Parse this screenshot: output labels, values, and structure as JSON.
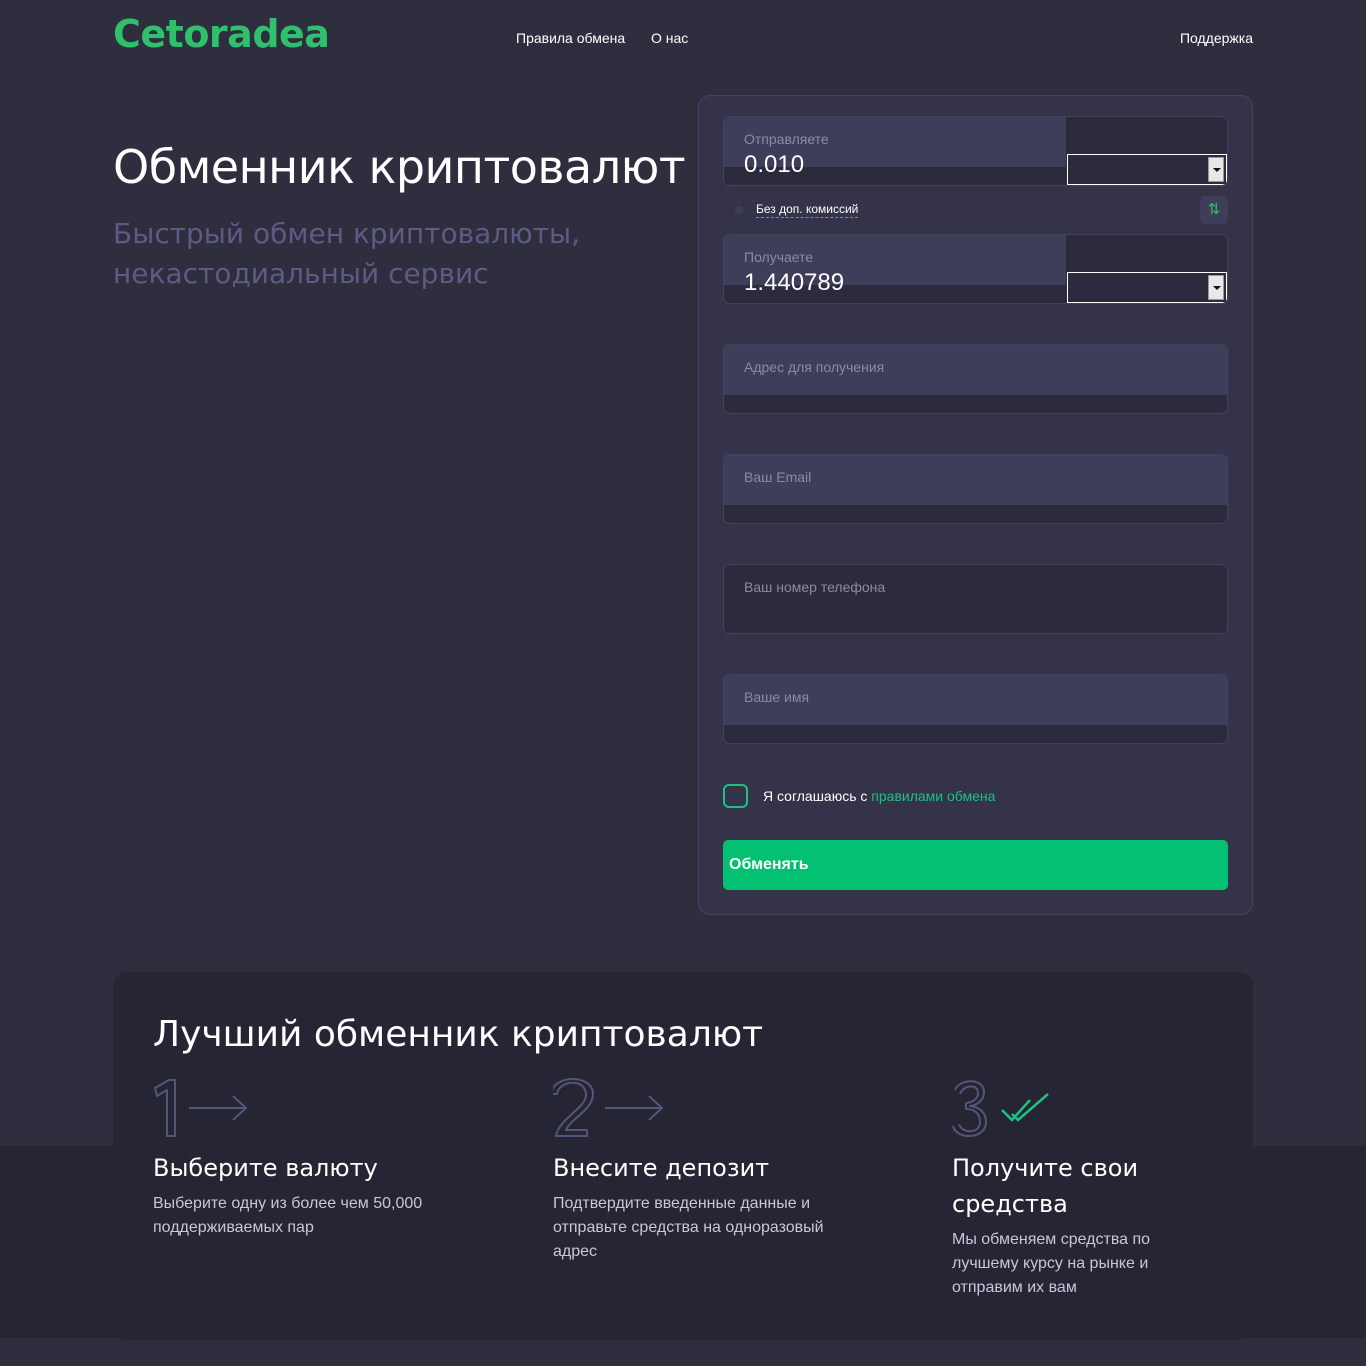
{
  "header": {
    "logo": "Cetoradea",
    "nav": {
      "rules": "Правила обмена",
      "about": "О нас",
      "support": "Поддержка"
    }
  },
  "hero": {
    "title": "Обменник криптовалют",
    "subtitle": "Быстрый обмен криптовалюты, некастодиальный сервис"
  },
  "form": {
    "send": {
      "label": "Отправляете",
      "value": "0.010"
    },
    "commission": "Без доп. комиссий",
    "swap_icon": "⇅",
    "receive": {
      "label": "Получаете",
      "value": "1.440789"
    },
    "address": {
      "label": "Адрес для получения"
    },
    "email": {
      "label": "Ваш Email"
    },
    "phone": {
      "label": "Ваш номер телефона"
    },
    "name": {
      "label": "Ваше имя"
    },
    "agree": {
      "text": "Я соглашаюсь с ",
      "link": "правилами обмена"
    },
    "submit": "Обменять"
  },
  "steps": {
    "title": "Лучший обменник криптовалют",
    "items": [
      {
        "number": "1",
        "title": "Выберите валюту",
        "description": "Выберите одну из более чем 50,000 поддерживаемых пар"
      },
      {
        "number": "2",
        "title": "Внесите депозит",
        "description": "Подтвердите введенные данные и отправьте средства на одноразовый адрес"
      },
      {
        "number": "3",
        "title": "Получите свои средства",
        "description": "Мы обменяем средства по лучшему курсу на рынке и отправим их вам"
      }
    ]
  },
  "colors": {
    "brand_green": "#2ec06a",
    "button_green": "#03c072",
    "background": "#2f2e3e"
  }
}
